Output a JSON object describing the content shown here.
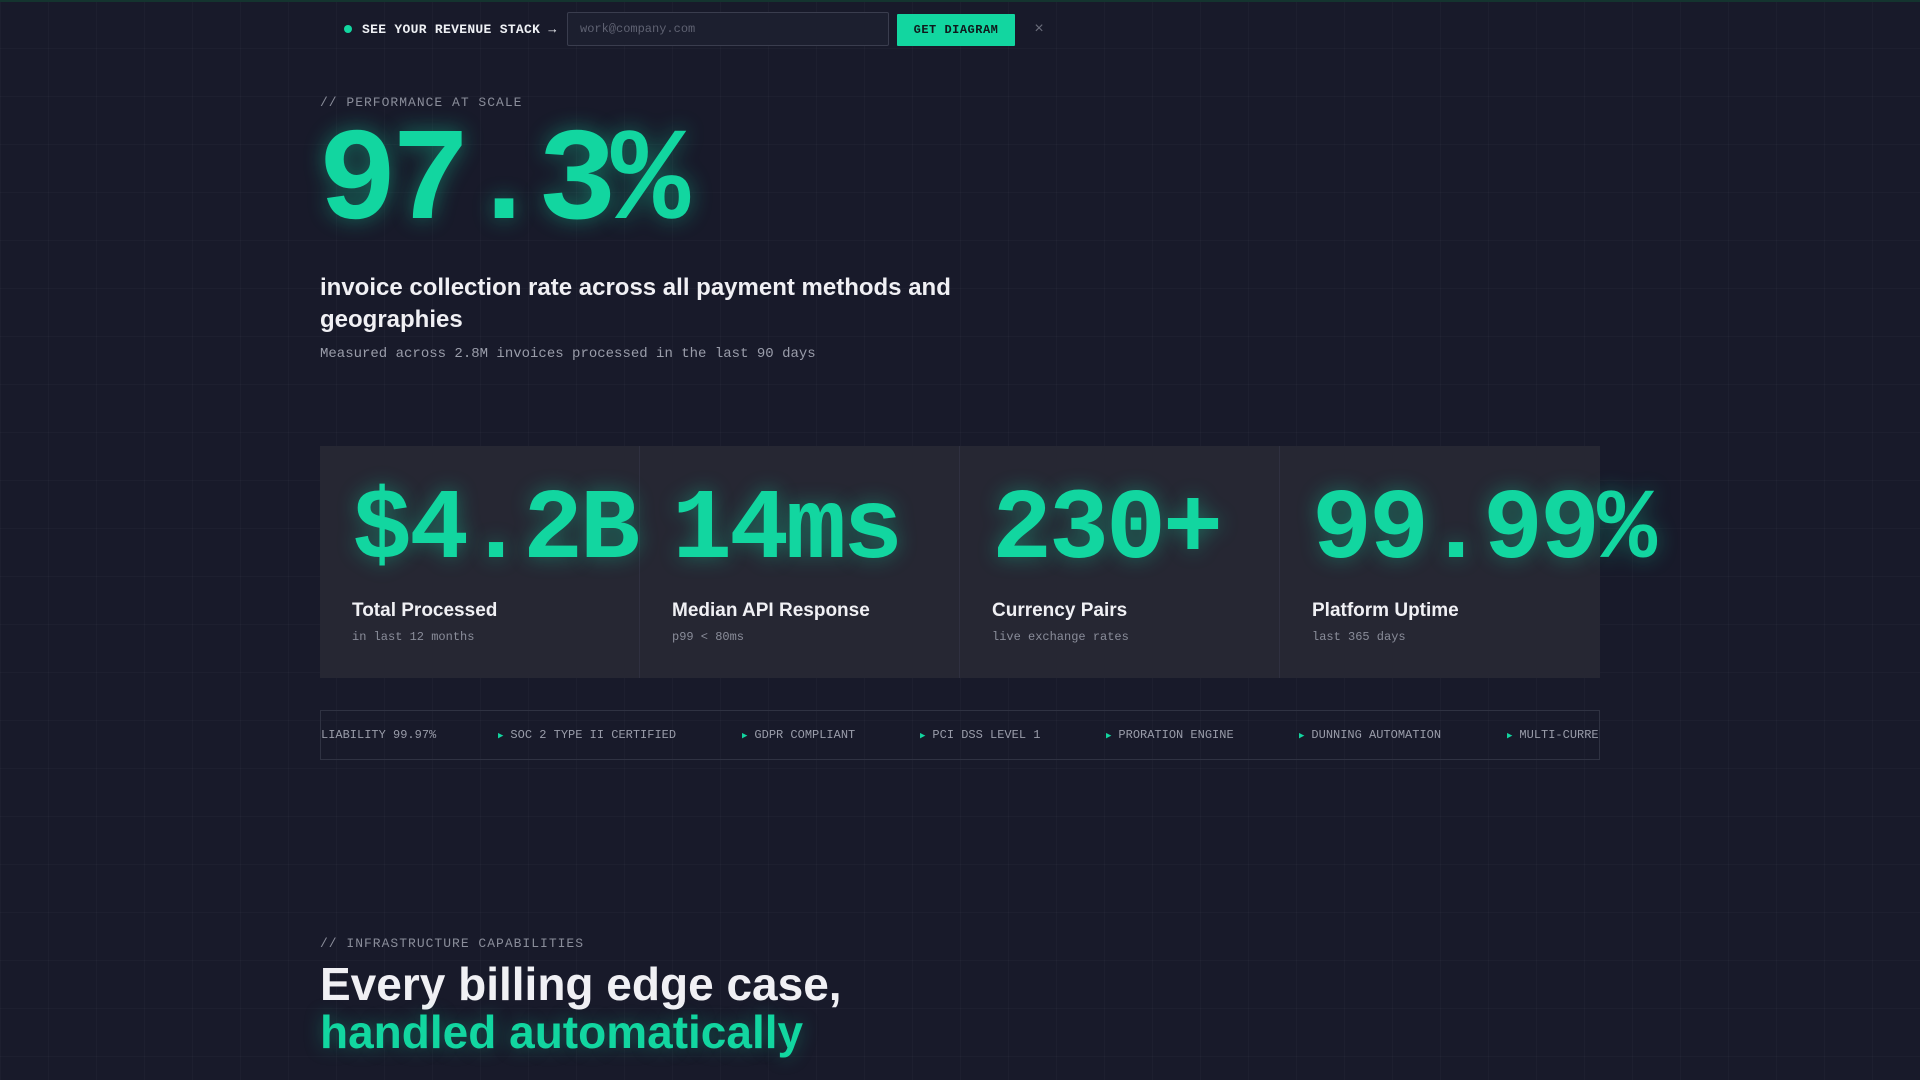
{
  "banner": {
    "label": "SEE YOUR REVENUE STACK →",
    "email_placeholder": "work@company.com",
    "button_label": "GET DIAGRAM",
    "close_glyph": "×"
  },
  "hero": {
    "eyebrow": "// PERFORMANCE AT SCALE",
    "value": "97.3%",
    "description": "invoice collection rate across all payment methods and geographies",
    "subtext": "Measured across 2.8M invoices processed in the last 90 days"
  },
  "stats": [
    {
      "value": "$4.2B",
      "label": "Total Processed",
      "sub": "in last 12 months"
    },
    {
      "value": "14ms",
      "label": "Median API Response",
      "sub": "p99 < 80ms"
    },
    {
      "value": "230+",
      "label": "Currency Pairs",
      "sub": "live exchange rates"
    },
    {
      "value": "99.99%",
      "label": "Platform Uptime",
      "sub": "last 365 days"
    }
  ],
  "ticker": [
    {
      "text": "LIABILITY 99.97%",
      "arrow": false
    },
    {
      "text": "SOC 2 TYPE II CERTIFIED",
      "arrow": true
    },
    {
      "text": "GDPR COMPLIANT",
      "arrow": true
    },
    {
      "text": "PCI DSS LEVEL 1",
      "arrow": true
    },
    {
      "text": "PRORATION ENGINE",
      "arrow": true
    },
    {
      "text": "DUNNING AUTOMATION",
      "arrow": true
    },
    {
      "text": "MULTI-CURRE",
      "arrow": true
    }
  ],
  "section": {
    "eyebrow": "// INFRASTRUCTURE CAPABILITIES",
    "title_line1": "Every billing edge case,",
    "title_line2": "handled automatically"
  },
  "colors": {
    "accent": "#12d6a0",
    "background": "#181a2a",
    "panel": "#262733"
  },
  "icons": {
    "status_dot": "status-dot-icon",
    "close": "close-icon",
    "ticker_arrow": "triangle-right-icon"
  }
}
